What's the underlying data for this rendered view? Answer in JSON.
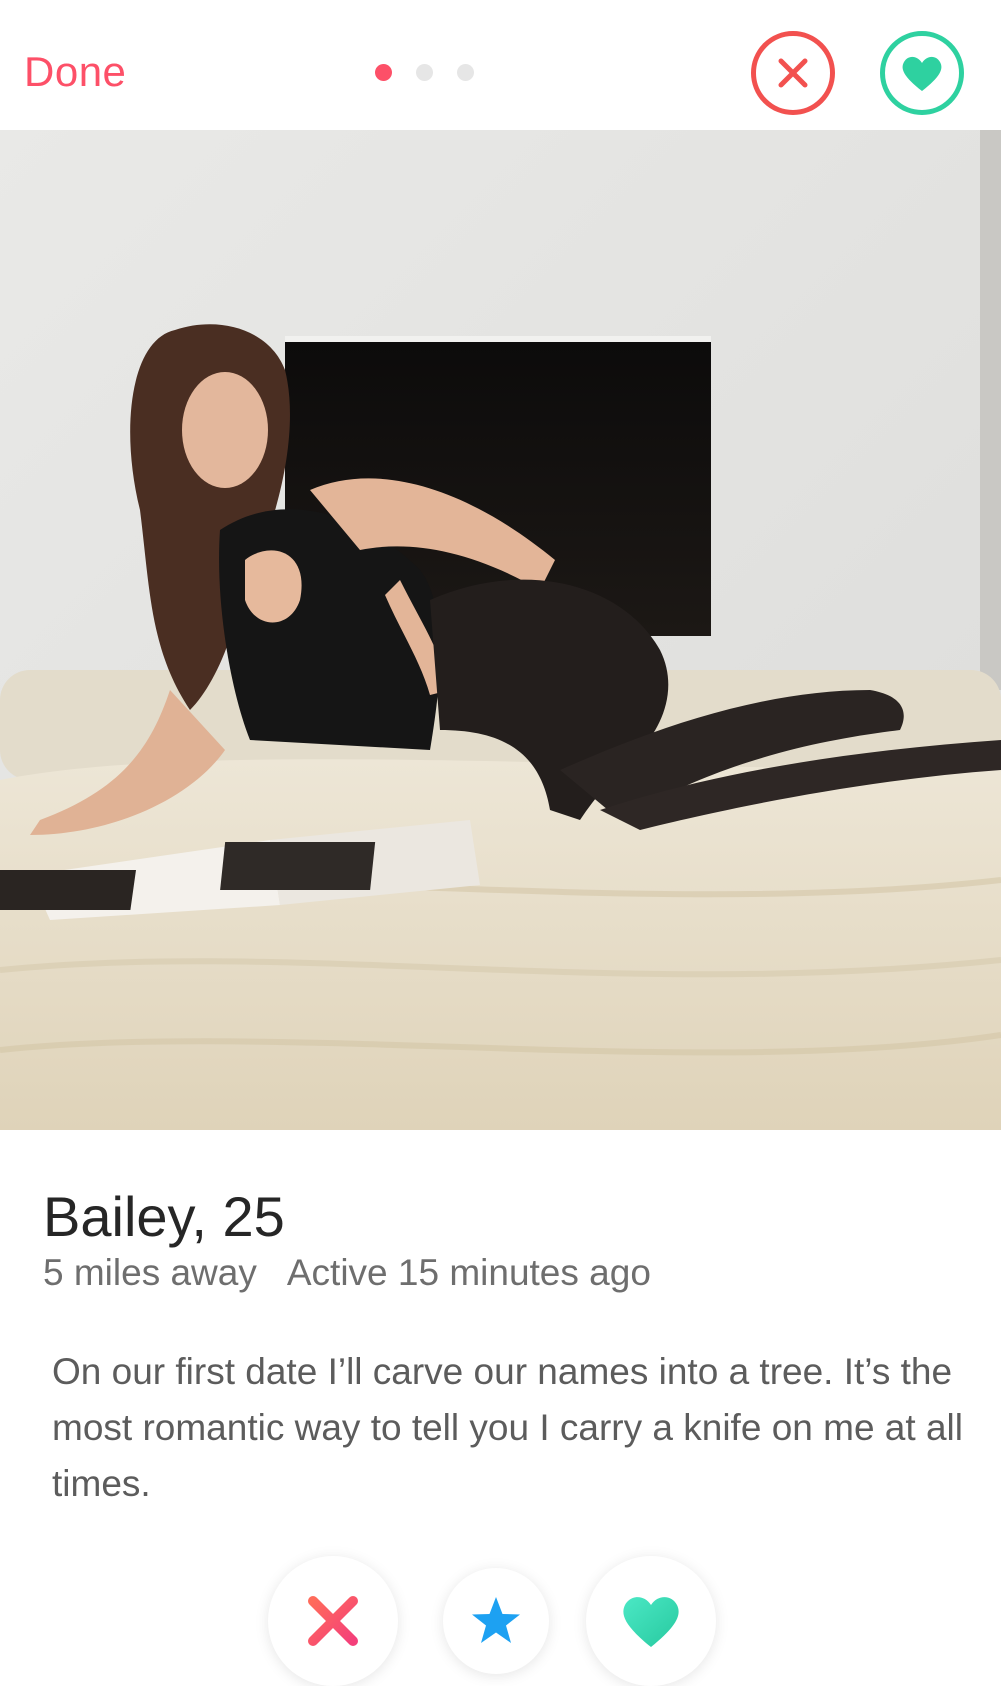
{
  "topbar": {
    "done_label": "Done",
    "photo_count": 3,
    "active_photo": 1
  },
  "profile": {
    "name_age": "Bailey, 25",
    "distance": "5 miles away",
    "active": "Active 15 minutes ago",
    "bio": "On our first date I’ll carve our names into a tree. It’s the most romantic way to tell you I carry a knife on me at all times."
  },
  "icons": {
    "top_pass": "close-circle-icon",
    "top_like": "heart-circle-icon",
    "bottom_pass": "x-icon",
    "bottom_star": "star-icon",
    "bottom_like": "heart-icon"
  },
  "colors": {
    "brand_red": "#fd5068",
    "pass_red": "#f2514f",
    "like_green": "#2ed1a0",
    "star_blue": "#1da1f2",
    "like_teal": "#3ce0b4"
  }
}
